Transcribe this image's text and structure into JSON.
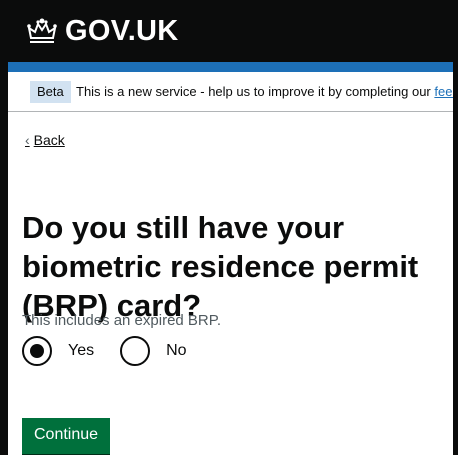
{
  "header": {
    "logotype": "GOV.UK",
    "crown_icon": "crown-icon"
  },
  "phase_banner": {
    "tag": "Beta",
    "text": "This is a new service - help us to improve it by completing our ",
    "link": "feedback"
  },
  "back_link": {
    "label": "Back",
    "icon": "chevron-left-icon"
  },
  "question": {
    "heading": "Do you still have your biometric residence permit (BRP) card?",
    "hint": "This includes an expired BRP.",
    "options": [
      {
        "label": "Yes",
        "selected": true
      },
      {
        "label": "No",
        "selected": false
      }
    ]
  },
  "actions": {
    "continue_label": "Continue"
  },
  "colors": {
    "header_bg": "#0b0c0c",
    "blue_bar": "#1d70b8",
    "tag_bg": "#d2e2f1",
    "button_green": "#00703c",
    "link_blue": "#1d70b8"
  }
}
